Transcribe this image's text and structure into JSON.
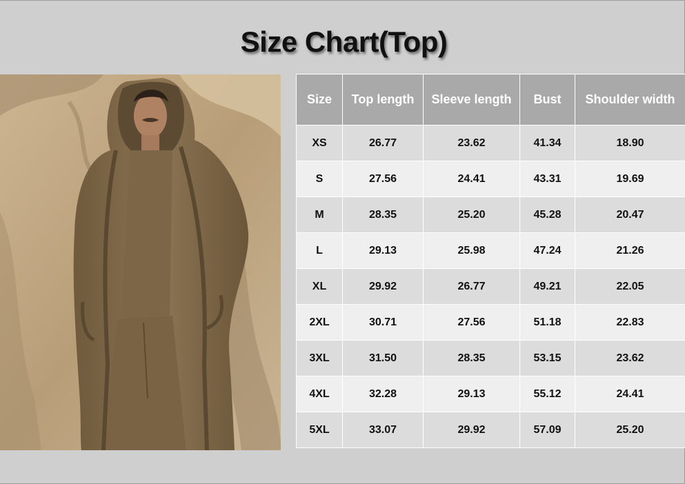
{
  "title": "Size Chart(Top)",
  "colors": {
    "background": "#cfcfcf",
    "header": "#a9a9a9",
    "row_odd": "#dcdcdc",
    "row_even": "#efefef",
    "garment": "#8a7352",
    "rock": "#c2ab87"
  },
  "product_photo": {
    "icon": "model-in-hooded-cardigan-photo"
  },
  "table": {
    "headers": [
      "Size",
      "Top length",
      "Sleeve length",
      "Bust",
      "Shoulder width"
    ],
    "rows": [
      [
        "XS",
        "26.77",
        "23.62",
        "41.34",
        "18.90"
      ],
      [
        "S",
        "27.56",
        "24.41",
        "43.31",
        "19.69"
      ],
      [
        "M",
        "28.35",
        "25.20",
        "45.28",
        "20.47"
      ],
      [
        "L",
        "29.13",
        "25.98",
        "47.24",
        "21.26"
      ],
      [
        "XL",
        "29.92",
        "26.77",
        "49.21",
        "22.05"
      ],
      [
        "2XL",
        "30.71",
        "27.56",
        "51.18",
        "22.83"
      ],
      [
        "3XL",
        "31.50",
        "28.35",
        "53.15",
        "23.62"
      ],
      [
        "4XL",
        "32.28",
        "29.13",
        "55.12",
        "24.41"
      ],
      [
        "5XL",
        "33.07",
        "29.92",
        "57.09",
        "25.20"
      ]
    ]
  }
}
